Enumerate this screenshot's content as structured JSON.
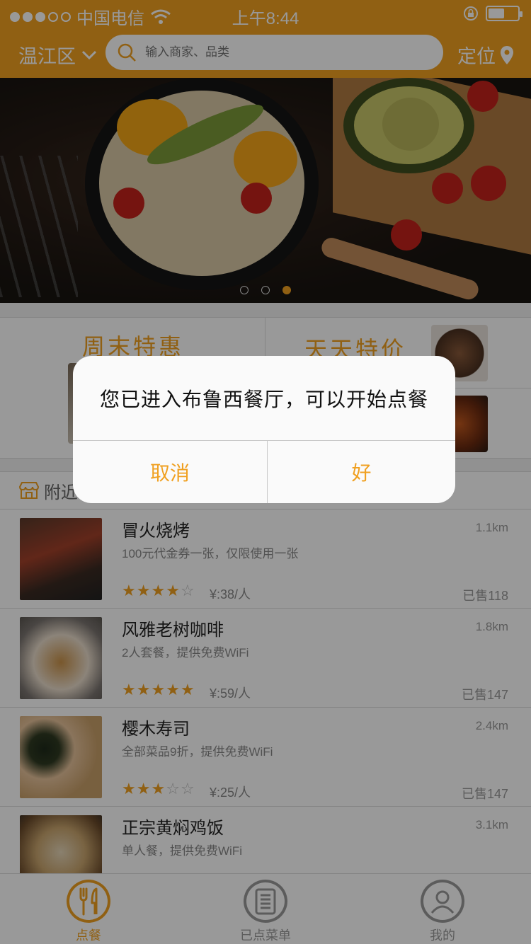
{
  "status_bar": {
    "carrier": "中国电信",
    "time": "上午8:44"
  },
  "header": {
    "district": "温江区",
    "search_placeholder": "输入商家、品类",
    "locate_label": "定位"
  },
  "banner": {
    "page_count": 3,
    "active_index": 2
  },
  "promos": {
    "weekend": "周末特惠",
    "daily": "天天特价"
  },
  "nearby": {
    "title": "附近"
  },
  "shops": [
    {
      "name": "冒火烧烤",
      "desc": "100元代金券一张，仅限使用一张",
      "distance": "1.1km",
      "rating": 4,
      "price": "¥:38/人",
      "sold": "已售118"
    },
    {
      "name": "风雅老树咖啡",
      "desc": "2人套餐，提供免费WiFi",
      "distance": "1.8km",
      "rating": 5,
      "price": "¥:59/人",
      "sold": "已售147"
    },
    {
      "name": "樱木寿司",
      "desc": "全部菜品9折，提供免费WiFi",
      "distance": "2.4km",
      "rating": 3,
      "price": "¥:25/人",
      "sold": "已售147"
    },
    {
      "name": "正宗黄焖鸡饭",
      "desc": "单人餐，提供免费WiFi",
      "distance": "3.1km"
    }
  ],
  "tabs": [
    {
      "label": "点餐",
      "icon": "cutlery-icon"
    },
    {
      "label": "已点菜单",
      "icon": "menu-list-icon"
    },
    {
      "label": "我的",
      "icon": "user-icon"
    }
  ],
  "dialog": {
    "message": "您已进入布鲁西餐厅，可以开始点餐",
    "cancel_label": "取消",
    "ok_label": "好"
  },
  "colors": {
    "accent": "#f0a020",
    "overlay": "rgba(0,0,0,0.4)"
  }
}
